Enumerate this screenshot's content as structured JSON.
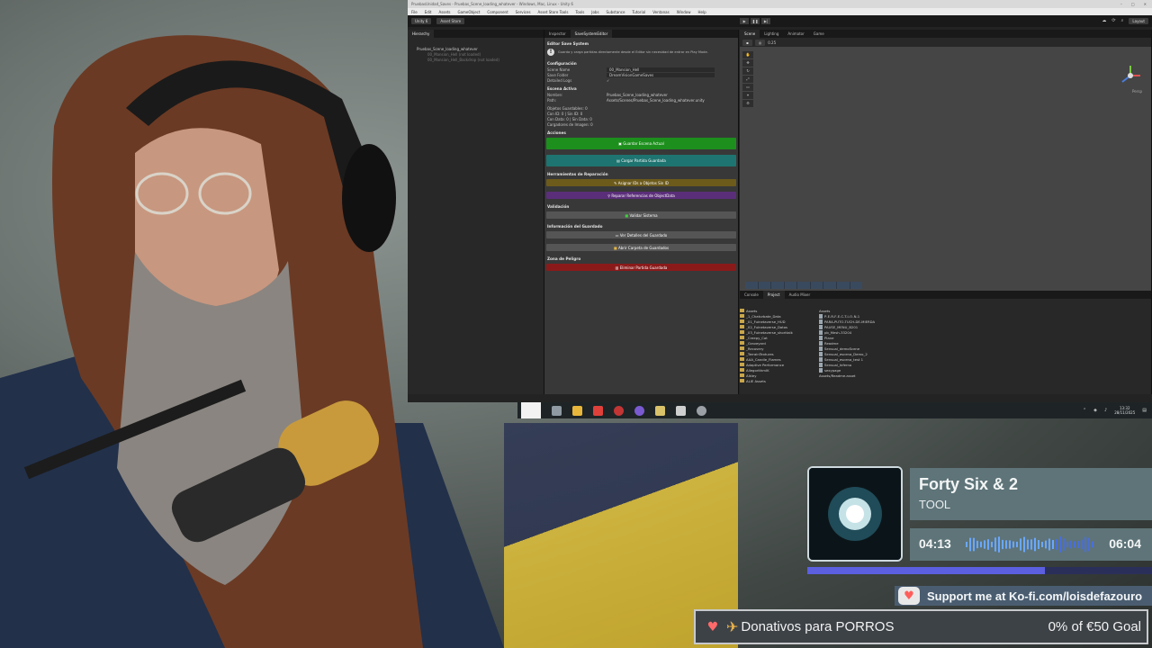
{
  "unity": {
    "title": "PruebasUnidad_Saves - Pruebas_Scene_loading_whatever - Windows, Mac, Linux - Unity 6",
    "menu": [
      "File",
      "Edit",
      "Assets",
      "GameObject",
      "Component",
      "Services",
      "Asset Store Tools",
      "Tools",
      "Jobs",
      "Substance",
      "Tutorial",
      "Ventanas",
      "Window",
      "Help"
    ],
    "toolbar": {
      "account": "Unity 6",
      "asset_store": "Asset Store",
      "layout": "Layout"
    },
    "hierarchy": {
      "tab": "Hierarchy",
      "rows": [
        {
          "label": "Pruebas_Scene_loading_whatever",
          "dim": false
        },
        {
          "label": "00_Mansion_Hell (not loaded)",
          "dim": true
        },
        {
          "label": "00_Mansion_Hell_Backdrop (not loaded)",
          "dim": true
        }
      ]
    },
    "inspector": {
      "tabs": [
        "Inspector",
        "SaveSystemEditor"
      ],
      "header": "Editor Save System",
      "help": "Guarda y carga partidas directamente desde el Editor sin necesidad de entrar en Play Mode.",
      "config_label": "Configuración",
      "config": [
        {
          "k": "Scene Name",
          "v": "00_Mansion_Hell"
        },
        {
          "k": "Save Folder",
          "v": "DreamVisionGameSaves"
        },
        {
          "k": "Detailed Logs",
          "v": "✓"
        }
      ],
      "active_label": "Escena Activa",
      "active": [
        {
          "k": "Nombre:",
          "v": "Pruebas_Scene_loading_whatever"
        },
        {
          "k": "Path:",
          "v": "Assets/Scenes/Pruebas_Scene_loading_whatever.unity"
        }
      ],
      "stats": [
        "Objetos Guardables: 0",
        "Con ID: 0 | Sin ID: 0",
        "Con Data: 0 | Sin Data: 0",
        "Cargadores de Imagen: 0"
      ],
      "actions_label": "Acciones",
      "save_scene": "Guardar Escena Actual",
      "load_game": "Cargar Partida Guardada",
      "repair_label": "Herramientas de Reparación",
      "assign_ids": "Asignar IDs a Objetos Sin ID",
      "repair_refs": "Reparar Referencias de ObjectData",
      "validation_label": "Validación",
      "validate": "Validar Sistema",
      "info_label": "Información del Guardado",
      "see_details": "Ver Detalles del Guardado",
      "open_folder": "Abrir Carpeta de Guardados",
      "danger_label": "Zona de Peligro",
      "delete_save": "Eliminar Partida Guardada"
    },
    "scene_tabs": [
      "Scene",
      "Lighting",
      "Animator",
      "Game"
    ],
    "scene_zoom": "0.25",
    "persp_label": "Persp",
    "project": {
      "tabs": [
        "Console",
        "Project",
        "Audio Mixer"
      ],
      "tree_root": "Assets",
      "tree": [
        "_1_Chaturbate_Data",
        "_01_Fuinetaverse_HUD",
        "_02_Fuinetaverse_Datos",
        "_03_Fuinetaverse_shorttalk",
        "_Creepy_Cat",
        "_Graveyard",
        "_Recovery",
        "_TerrainTextures",
        "AAA_Candle_Flames",
        "Adaptive Performance",
        "AllegorithmIK",
        "Alkley",
        "ALIE Assets"
      ],
      "files_root": "Assets",
      "files": [
        "P-E-R-F-E-C-T-I-O-N-1",
        "PARA-PUTO-TUCH-DE-MIERDA",
        "PAUSE_MENU_B201",
        "pb_Mesh-33204",
        "Plane",
        "Readme",
        "Sensual_demoScene",
        "Sensual_escena_Demo_2",
        "Sensual_escena_test 1",
        "Sensual_Inferno",
        "sexypage"
      ],
      "footer_path": "Assets/Readme.asset"
    }
  },
  "taskbar": {
    "time": "13:32",
    "date": "28/11/2025",
    "icons": [
      "task-view-icon",
      "file-explorer-icon",
      "vivaldi-icon",
      "media-icon",
      "browser-icon",
      "files-icon",
      "unity-icon",
      "settings-icon"
    ]
  },
  "now_playing": {
    "title": "Forty Six & 2",
    "artist": "TOOL",
    "current": "04:13",
    "total": "06:04",
    "progress": 0.69,
    "color_panel": "#5e7479",
    "color_bar": "#5b5fe0"
  },
  "kofi": {
    "text": "Support me at Ko-fi.com/loisdefazouro"
  },
  "goal": {
    "title": "Donativos para PORROS",
    "amount": "0% of €50 Goal",
    "icon": "rocket-icon"
  }
}
